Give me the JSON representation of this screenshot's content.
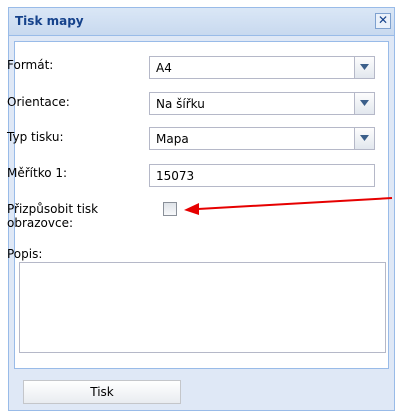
{
  "window": {
    "title": "Tisk mapy",
    "close_icon": "close-icon"
  },
  "form": {
    "format_label": "Formát:",
    "format_value": "A4",
    "orientation_label": "Orientace:",
    "orientation_value": "Na šířku",
    "print_type_label": "Typ tisku:",
    "print_type_value": "Mapa",
    "scale_label": "Měřítko 1:",
    "scale_value": "15073",
    "fit_screen_label": "Přizpůsobit tisk obrazovce:",
    "fit_screen_checked": false,
    "description_label": "Popis:",
    "description_value": ""
  },
  "actions": {
    "print_label": "Tisk"
  },
  "colors": {
    "title": "#15428b",
    "arrow": "#e60000"
  }
}
